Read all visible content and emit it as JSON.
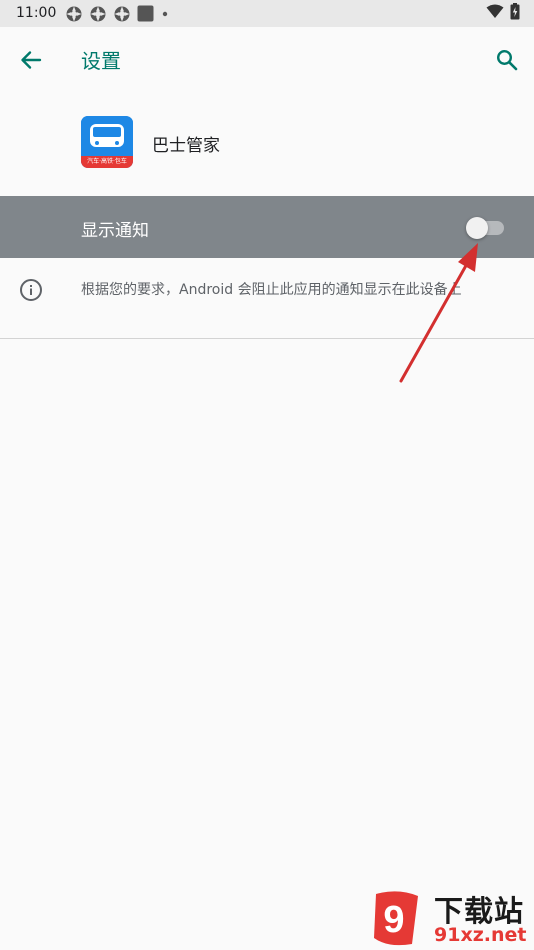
{
  "status_bar": {
    "time": "11:00"
  },
  "header": {
    "title": "设置",
    "back_icon": "arrow-left-icon",
    "search_icon": "search-icon"
  },
  "app": {
    "name": "巴士管家",
    "icon_caption": "汽车·高铁·包车"
  },
  "notification_toggle": {
    "label": "显示通知",
    "enabled": false
  },
  "info": {
    "icon": "info-icon",
    "text": "根据您的要求，Android 会阻止此应用的通知显示在此设备上"
  },
  "watermark": {
    "logo_text": "9",
    "title": "下载站",
    "url": "91xz.net"
  },
  "colors": {
    "accent": "#00796b",
    "toggle_row_bg": "#80868b",
    "annotation_arrow": "#d32f2f",
    "watermark_red": "#e53935"
  }
}
